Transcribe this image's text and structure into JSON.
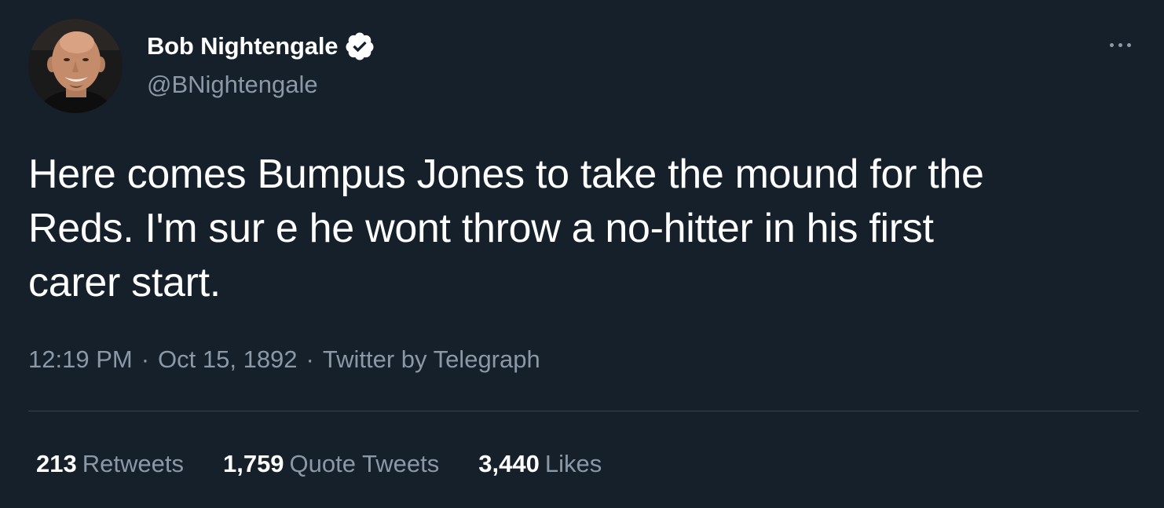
{
  "author": {
    "display_name": "Bob Nightengale",
    "handle": "@BNightengale",
    "verified": true
  },
  "tweet": {
    "text": "Here comes Bumpus Jones to take the mound for the\nReds. I'm sur e he wont throw a no-hitter in his first\ncarer start.",
    "time": "12:19 PM",
    "date": "Oct 15, 1892",
    "separator": "·",
    "source": "Twitter by Telegraph"
  },
  "stats": [
    {
      "count": "213",
      "label": "Retweets"
    },
    {
      "count": "1,759",
      "label": "Quote Tweets"
    },
    {
      "count": "3,440",
      "label": "Likes"
    }
  ],
  "icons": {
    "verified": "verified-badge-icon",
    "more": "more-options-icon"
  },
  "colors": {
    "background": "#15202b",
    "primary_text": "#ffffff",
    "secondary_text": "#8b98a5",
    "divider": "#38444d"
  }
}
